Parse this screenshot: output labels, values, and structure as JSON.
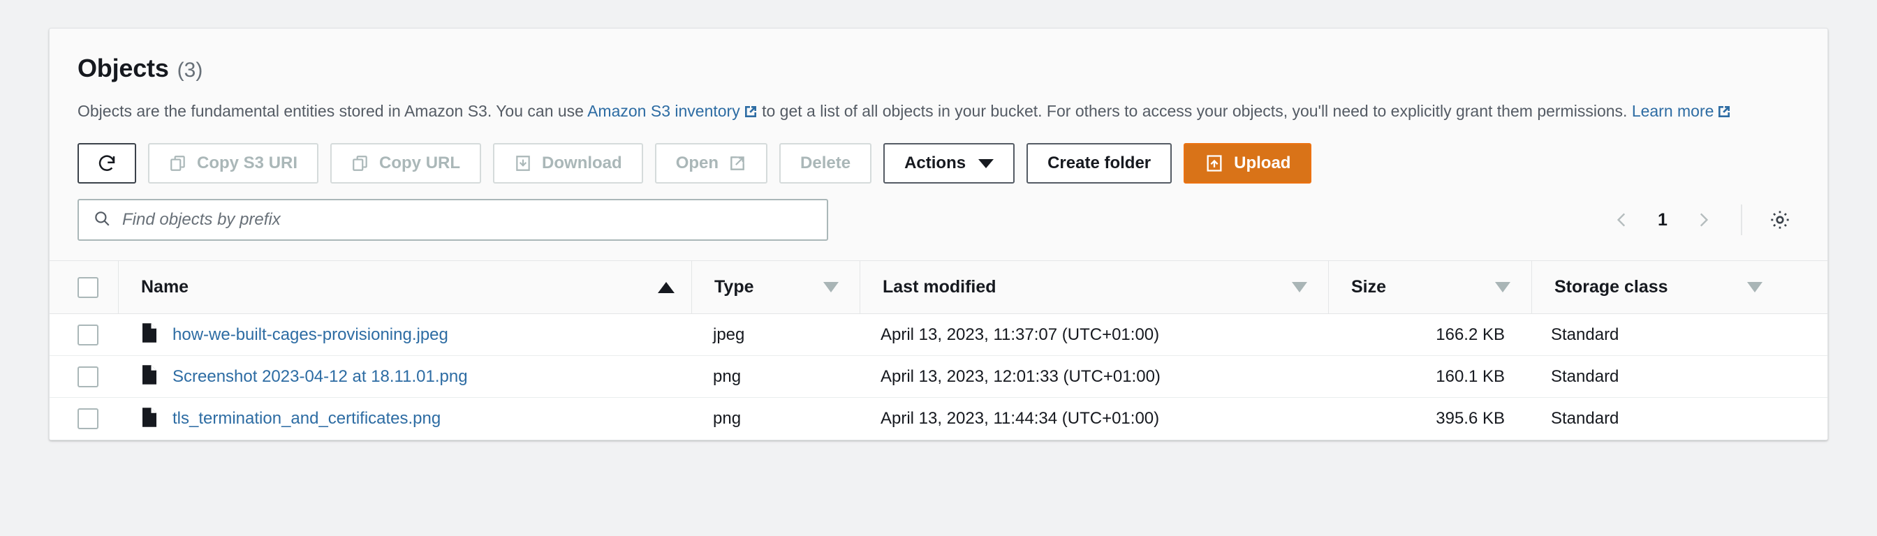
{
  "panel": {
    "title": "Objects",
    "count": "(3)",
    "description_parts": {
      "p1": "Objects are the fundamental entities stored in Amazon S3. You can use ",
      "link1": "Amazon S3 inventory",
      "p2": " to get a list of all objects in your bucket. For others to access your objects, you'll need to explicitly grant them permissions. ",
      "link2": "Learn more"
    }
  },
  "toolbar": {
    "refresh_label": "",
    "copy_s3_uri_label": "Copy S3 URI",
    "copy_url_label": "Copy URL",
    "download_label": "Download",
    "open_label": "Open",
    "delete_label": "Delete",
    "actions_label": "Actions",
    "create_folder_label": "Create folder",
    "upload_label": "Upload"
  },
  "search": {
    "placeholder": "Find objects by prefix",
    "value": ""
  },
  "pagination": {
    "prev_label": "‹",
    "page": "1",
    "next_label": "›"
  },
  "table": {
    "columns": [
      {
        "label": "Name",
        "sort": "asc"
      },
      {
        "label": "Type",
        "sort": "none"
      },
      {
        "label": "Last modified",
        "sort": "none"
      },
      {
        "label": "Size",
        "sort": "none"
      },
      {
        "label": "Storage class",
        "sort": "none"
      }
    ],
    "rows": [
      {
        "name": "how-we-built-cages-provisioning.jpeg",
        "type": "jpeg",
        "last_modified": "April 13, 2023, 11:37:07 (UTC+01:00)",
        "size": "166.2 KB",
        "storage_class": "Standard"
      },
      {
        "name": "Screenshot 2023-04-12 at 18.11.01.png",
        "type": "png",
        "last_modified": "April 13, 2023, 12:01:33 (UTC+01:00)",
        "size": "160.1 KB",
        "storage_class": "Standard"
      },
      {
        "name": "tls_termination_and_certificates.png",
        "type": "png",
        "last_modified": "April 13, 2023, 11:44:34 (UTC+01:00)",
        "size": "395.6 KB",
        "storage_class": "Standard"
      }
    ]
  },
  "colors": {
    "accent_orange": "#d97318",
    "link_blue": "#2d6ca3",
    "page_bg": "#f1f2f3",
    "panel_bg": "#fafafa",
    "text_primary": "#16191f",
    "text_secondary": "#545b64",
    "disabled": "#aab7b8"
  }
}
